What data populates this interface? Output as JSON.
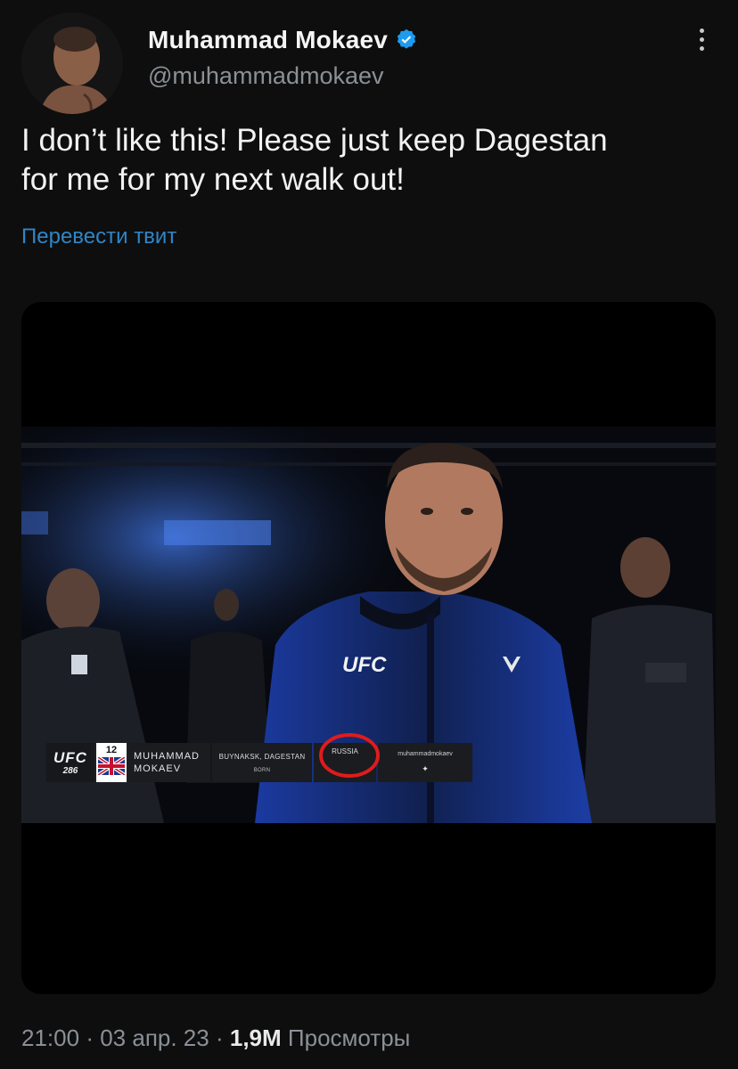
{
  "author": {
    "display_name": "Muhammad Mokaev",
    "handle": "@muhammadmokaev",
    "verified_icon": "verified-badge-icon",
    "avatar_icon": "avatar"
  },
  "tweet": {
    "text_line1": "I don’t like this! Please just keep Dagestan",
    "text_line2": "for me for my next walk out!",
    "translate_label": "Перевести твит"
  },
  "media": {
    "overlay": {
      "logo_line1": "UFC",
      "logo_line2": "286",
      "rank": "12",
      "first_name": "MUHAMMAD",
      "last_name": "MOKAEV",
      "born_place": "BUYNAKSK, DAGESTAN",
      "born_label": "BORN",
      "country": "RUSSIA",
      "social_handle": "muhammadmokaev",
      "social_icon": "bird-icon"
    },
    "jacket_logo": "UFC"
  },
  "footer": {
    "time": "21:00",
    "separator": "·",
    "date": "03 апр. 23",
    "views_count": "1,9M",
    "views_label": "Просмотры"
  },
  "colors": {
    "background": "#0e0e0e",
    "link": "#2f86c6",
    "verified": "#1d9bf0",
    "annotation": "#e01b1b"
  }
}
